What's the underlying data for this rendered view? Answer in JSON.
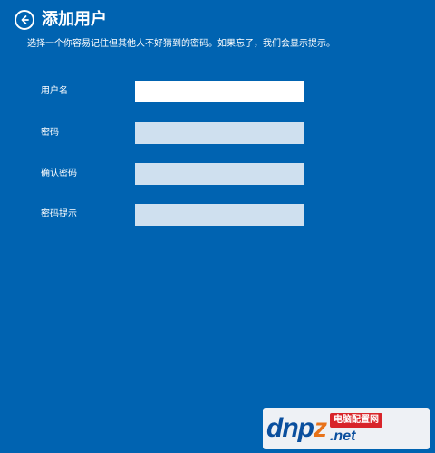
{
  "header": {
    "title": "添加用户",
    "subtitle": "选择一个你容易记住但其他人不好猜到的密码。如果忘了，我们会显示提示。"
  },
  "form": {
    "username_label": "用户名",
    "username_value": "",
    "password_label": "密码",
    "password_value": "",
    "confirm_label": "确认密码",
    "confirm_value": "",
    "hint_label": "密码提示",
    "hint_value": ""
  },
  "watermark": {
    "logo_prefix": "dnp",
    "logo_z": "z",
    "badge": "电脑配置网",
    "domain": ".net"
  },
  "colors": {
    "background": "#0063b1",
    "active_input": "#ffffff",
    "inactive_input": "#cfe0ef"
  }
}
